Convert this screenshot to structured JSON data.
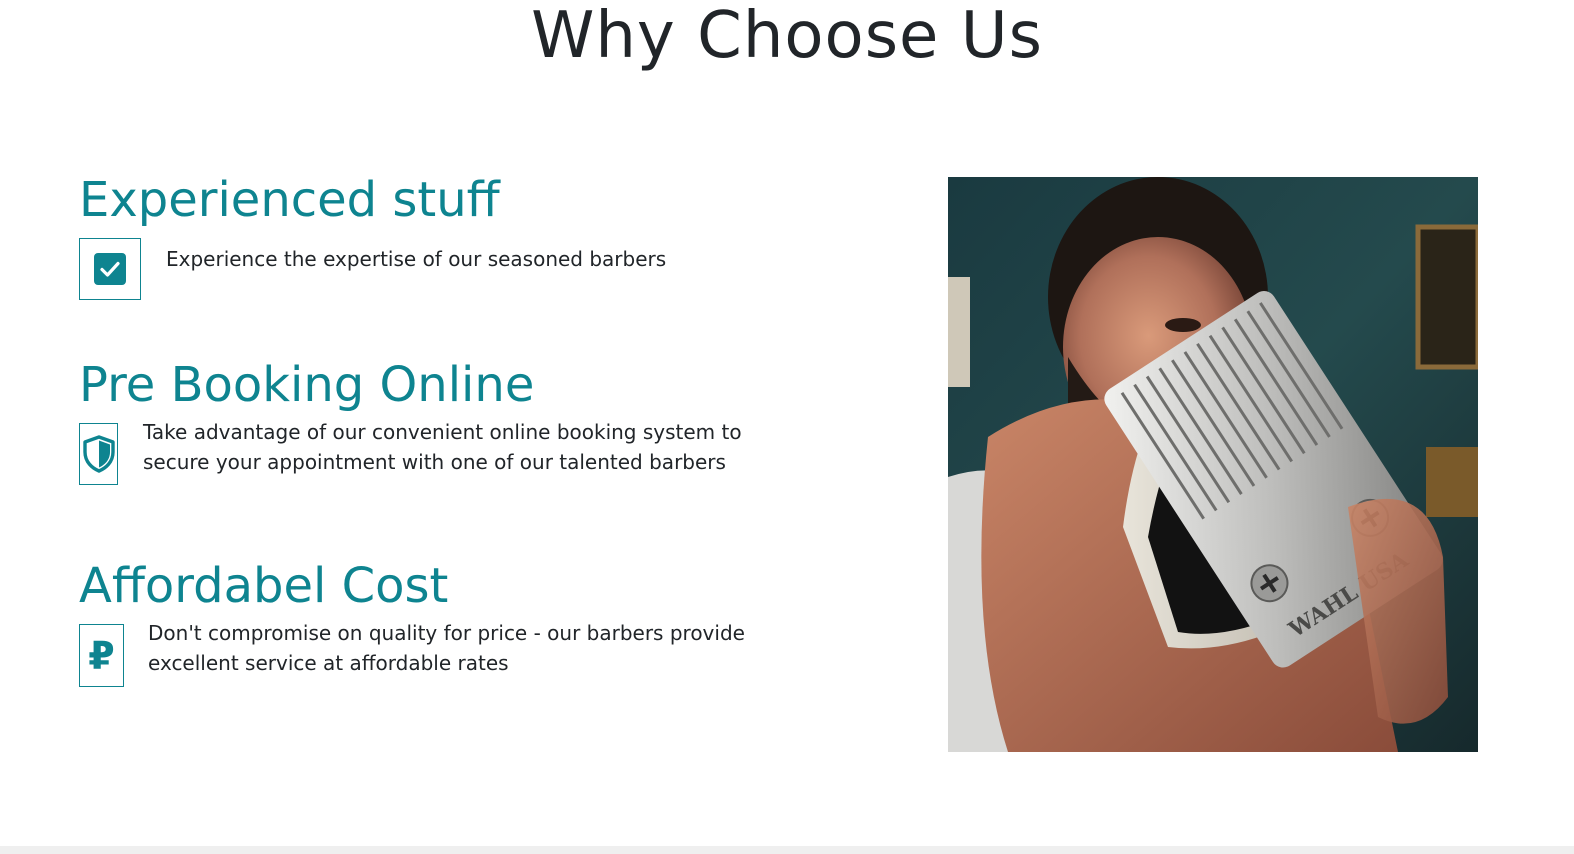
{
  "section": {
    "title": "Why Choose Us"
  },
  "features": [
    {
      "heading": "Experienced stuff",
      "text": "Experience the expertise of our seasoned barbers",
      "icon": "check-square-icon"
    },
    {
      "heading": "Pre Booking Online",
      "text": "Take advantage of our convenient online booking system to secure your appointment with one of our talented barbers",
      "icon": "shield-icon"
    },
    {
      "heading": "Affordabel Cost",
      "text": "Don't compromise on quality for price - our barbers provide excellent service at affordable rates",
      "icon": "ruble-icon",
      "icon_glyph": "₽"
    }
  ],
  "photo": {
    "brand_text": "WAHL USA"
  },
  "colors": {
    "accent": "#0e8490",
    "text": "#212529",
    "background": "#ffffff"
  }
}
